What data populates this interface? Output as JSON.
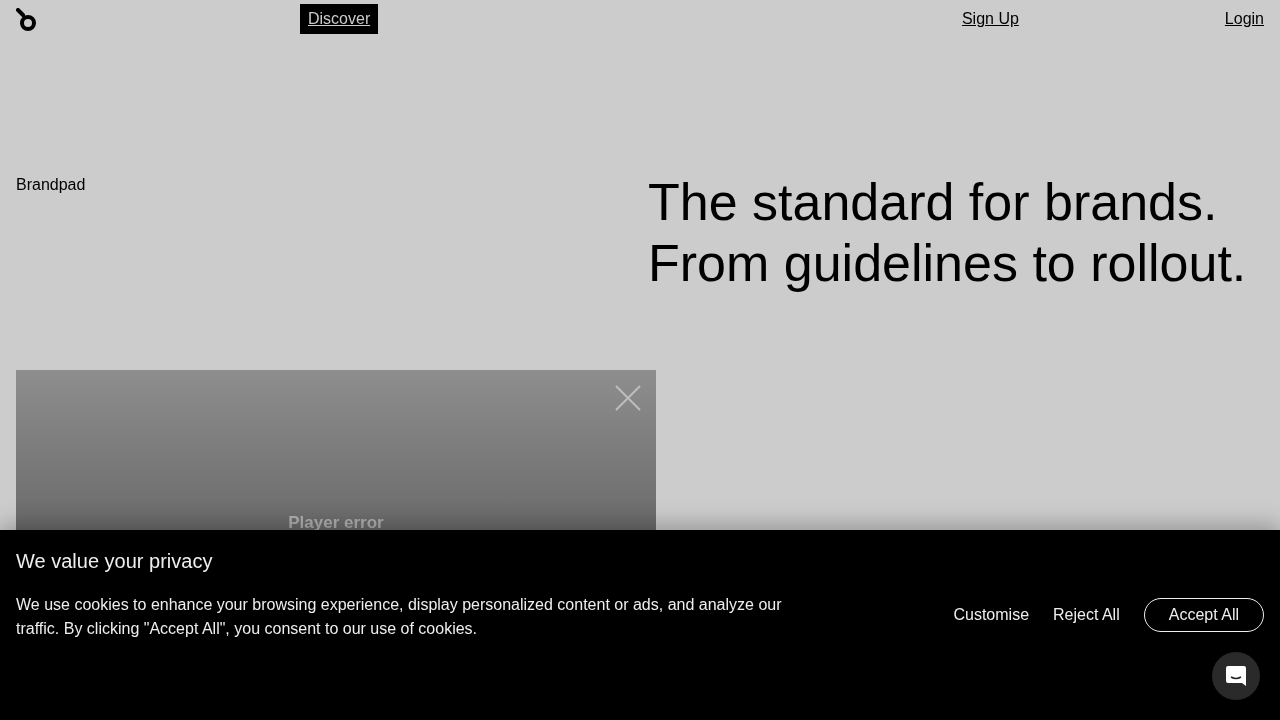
{
  "nav": {
    "links": [
      {
        "label": "Discover",
        "selected": true
      },
      {
        "label": "Sign Up",
        "selected": false
      },
      {
        "label": "Login",
        "selected": false
      }
    ]
  },
  "hero": {
    "brand": "Brandpad",
    "headline": [
      "The standard for brands.",
      "From guidelines to rollout."
    ]
  },
  "video": {
    "error": "Player error"
  },
  "cookie_banner": {
    "title": "We value your privacy",
    "text": "We use cookies to enhance your browsing experience, display personalized content or ads, and analyze our traffic. By clicking \"Accept All\", you consent to our use of cookies.",
    "buttons": [
      {
        "label": "Customise",
        "kind": "text"
      },
      {
        "label": "Reject All",
        "kind": "text"
      },
      {
        "label": "Accept All",
        "kind": "outline"
      }
    ]
  }
}
